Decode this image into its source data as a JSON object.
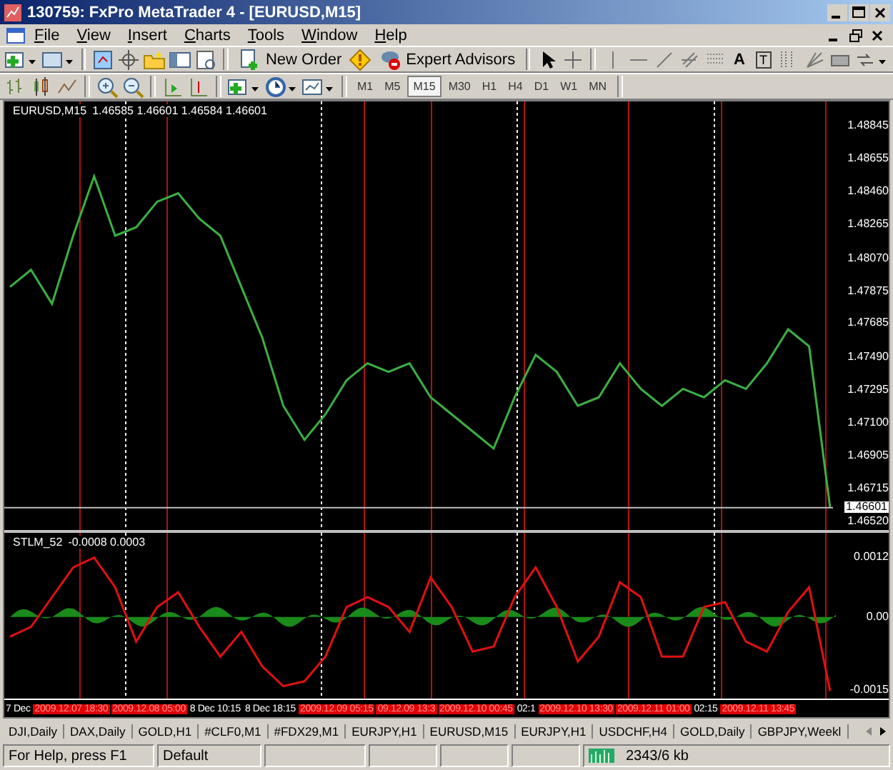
{
  "window": {
    "title": "130759: FxPro MetaTrader 4 - [EURUSD,M15]"
  },
  "menu": [
    "File",
    "View",
    "Insert",
    "Charts",
    "Tools",
    "Window",
    "Help"
  ],
  "toolbar": {
    "new_order": "New Order",
    "expert_advisors": "Expert Advisors",
    "text_tool": "A",
    "label_tool": "T"
  },
  "periods": [
    {
      "label": "M1",
      "selected": false
    },
    {
      "label": "M5",
      "selected": false
    },
    {
      "label": "M15",
      "selected": true
    },
    {
      "label": "M30",
      "selected": false
    },
    {
      "label": "H1",
      "selected": false
    },
    {
      "label": "H4",
      "selected": false
    },
    {
      "label": "D1",
      "selected": false
    },
    {
      "label": "W1",
      "selected": false
    },
    {
      "label": "MN",
      "selected": false
    }
  ],
  "chart": {
    "legend": "1.46585 1.46601 1.46584 1.46601",
    "chart_data": {
      "type": "line",
      "ylim": [
        1.4647,
        1.4899
      ],
      "grid": true,
      "ref_lines": [
        {
          "axis": "y",
          "value": 1.46601,
          "label": "1.46601"
        }
      ],
      "yticks": [
        {
          "value": 1.48845,
          "label": "1.48845"
        },
        {
          "value": 1.48655,
          "label": "1.48655"
        },
        {
          "value": 1.4846,
          "label": "1.48460"
        },
        {
          "value": 1.48265,
          "label": "1.48265"
        },
        {
          "value": 1.4807,
          "label": "1.48070"
        },
        {
          "value": 1.47875,
          "label": "1.47875"
        },
        {
          "value": 1.47685,
          "label": "1.47685"
        },
        {
          "value": 1.4749,
          "label": "1.47490"
        },
        {
          "value": 1.47295,
          "label": "1.47295"
        },
        {
          "value": 1.471,
          "label": "1.47100"
        },
        {
          "value": 1.46905,
          "label": "1.46905"
        },
        {
          "value": 1.46715,
          "label": "1.46715"
        },
        {
          "value": 1.4652,
          "label": "1.46520"
        }
      ],
      "title": "EURUSD,M15",
      "series": [
        {
          "color": "#3cb043",
          "values": [
            1.479,
            1.48,
            1.478,
            1.482,
            1.4855,
            1.482,
            1.4825,
            1.484,
            1.4845,
            1.483,
            1.482,
            1.479,
            1.476,
            1.472,
            1.47,
            1.4715,
            1.4735,
            1.4745,
            1.474,
            1.4745,
            1.4725,
            1.4715,
            1.4705,
            1.4695,
            1.4725,
            1.475,
            1.474,
            1.472,
            1.4725,
            1.4745,
            1.473,
            1.472,
            1.473,
            1.4725,
            1.4735,
            1.473,
            1.4745,
            1.4765,
            1.4755,
            1.466
          ]
        }
      ]
    }
  },
  "indicator": {
    "legend": "-0.0008 0.0003",
    "chart_data": {
      "type": "line",
      "ylim": [
        -0.00165,
        0.0017
      ],
      "grid": true,
      "yticks": [
        {
          "value": 0.0012,
          "label": "0.0012"
        },
        {
          "value": 0,
          "label": "0.00"
        },
        {
          "value": -0.0015,
          "label": "-0.0015"
        }
      ],
      "series": [
        {
          "name": "STLM_52",
          "color": "#e01010",
          "values": [
            -0.0004,
            -0.0002,
            0.0004,
            0.001,
            0.0012,
            0.0006,
            -0.0005,
            0.0002,
            0.0005,
            -0.0002,
            -0.0008,
            -0.0003,
            -0.001,
            -0.0014,
            -0.0013,
            -0.0008,
            0.0002,
            0.0004,
            0.0002,
            -0.0003,
            0.0008,
            0.0002,
            -0.0007,
            -0.0006,
            0.0004,
            0.001,
            0.0002,
            -0.0009,
            -0.0004,
            0.0007,
            0.0004,
            -0.0008,
            -0.0008,
            0.0002,
            0.0003,
            -0.0005,
            -0.0007,
            0.0001,
            0.0006,
            -0.0015
          ]
        }
      ]
    }
  },
  "time_axis": [
    {
      "text": "7 Dec",
      "kind": "date"
    },
    {
      "text": "2009.12.07 18:30",
      "kind": "marker"
    },
    {
      "text": "2009.12.08 05:00",
      "kind": "marker"
    },
    {
      "text": "8 Dec 10:15",
      "kind": "date"
    },
    {
      "text": "8 Dec 18:15",
      "kind": "date"
    },
    {
      "text": "2009.12.09 05:15",
      "kind": "marker"
    },
    {
      "text": "09.12.09 13:3",
      "kind": "marker"
    },
    {
      "text": "2009.12.10 00:45",
      "kind": "marker"
    },
    {
      "text": "02:1",
      "kind": "date"
    },
    {
      "text": "2009.12.10 13:30",
      "kind": "marker"
    },
    {
      "text": "2009.12.11 01:00",
      "kind": "marker"
    },
    {
      "text": "02:15",
      "kind": "date"
    },
    {
      "text": "2009.12.11 13:45",
      "kind": "marker"
    }
  ],
  "tabs": [
    "DJI,Daily",
    "DAX,Daily",
    "GOLD,H1",
    "#CLF0,M1",
    "#FDX29,M1",
    "EURJPY,H1",
    "EURUSD,M15",
    "EURJPY,H1",
    "USDCHF,H4",
    "GOLD,Daily",
    "GBPJPY,Weekl"
  ],
  "status_bar": {
    "help": "For Help, press F1",
    "profile": "Default",
    "traffic": "2343/6 kb"
  }
}
